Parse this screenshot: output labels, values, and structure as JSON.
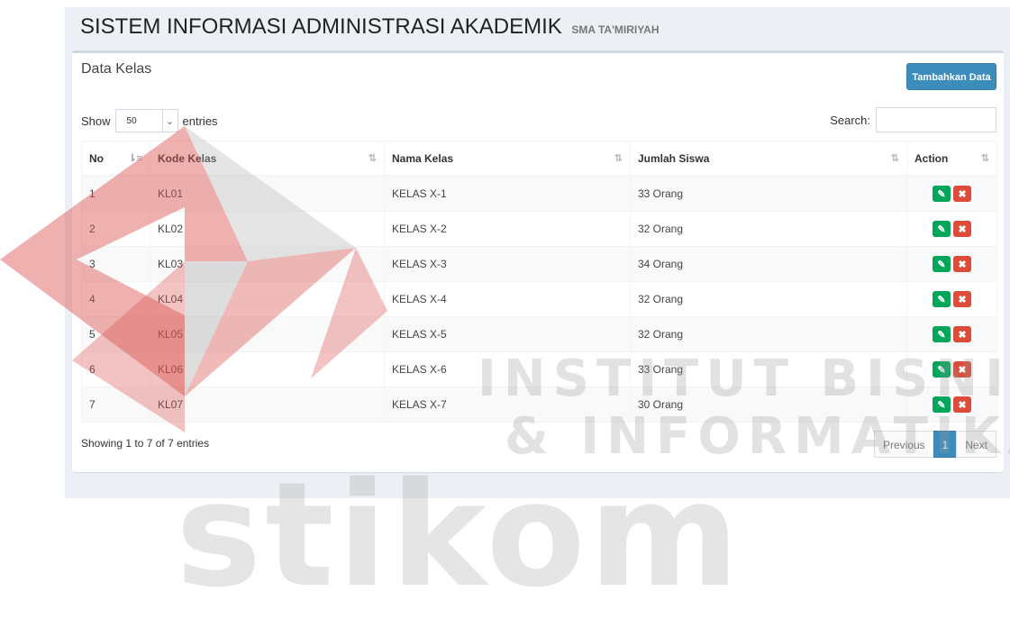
{
  "header": {
    "title": "SISTEM INFORMASI ADMINISTRASI AKADEMIK",
    "subtitle": "SMA TA'MIRIYAH"
  },
  "box": {
    "title": "Data Kelas",
    "add_button": "Tambahkan Data"
  },
  "length": {
    "show_label": "Show",
    "selected": "50",
    "entries_label": "entries"
  },
  "search": {
    "label": "Search:",
    "value": ""
  },
  "table": {
    "columns": [
      "No",
      "Kode Kelas",
      "Nama Kelas",
      "Jumlah Siswa",
      "Action"
    ],
    "rows": [
      {
        "no": "1",
        "kode": "KL01",
        "nama": "KELAS X-1",
        "jumlah": "33 Orang"
      },
      {
        "no": "2",
        "kode": "KL02",
        "nama": "KELAS X-2",
        "jumlah": "32 Orang"
      },
      {
        "no": "3",
        "kode": "KL03",
        "nama": "KELAS X-3",
        "jumlah": "34 Orang"
      },
      {
        "no": "4",
        "kode": "KL04",
        "nama": "KELAS X-4",
        "jumlah": "32 Orang"
      },
      {
        "no": "5",
        "kode": "KL05",
        "nama": "KELAS X-5",
        "jumlah": "32 Orang"
      },
      {
        "no": "6",
        "kode": "KL06",
        "nama": "KELAS X-6",
        "jumlah": "33 Orang"
      },
      {
        "no": "7",
        "kode": "KL07",
        "nama": "KELAS X-7",
        "jumlah": "30 Orang"
      }
    ]
  },
  "footer": {
    "info": "Showing 1 to 7 of 7 entries",
    "prev": "Previous",
    "page": "1",
    "next": "Next"
  },
  "watermark": {
    "line1": "INSTITUT BISNIS",
    "line2": "& INFORMATIKA",
    "line3": "stikom"
  },
  "colors": {
    "primary": "#3c8dbc",
    "edit": "#00a65a",
    "delete": "#dd4b39",
    "watermark_red": "#d9534f"
  },
  "icons": {
    "edit": "edit-icon",
    "delete": "times-icon",
    "sort": "sort-icon"
  }
}
